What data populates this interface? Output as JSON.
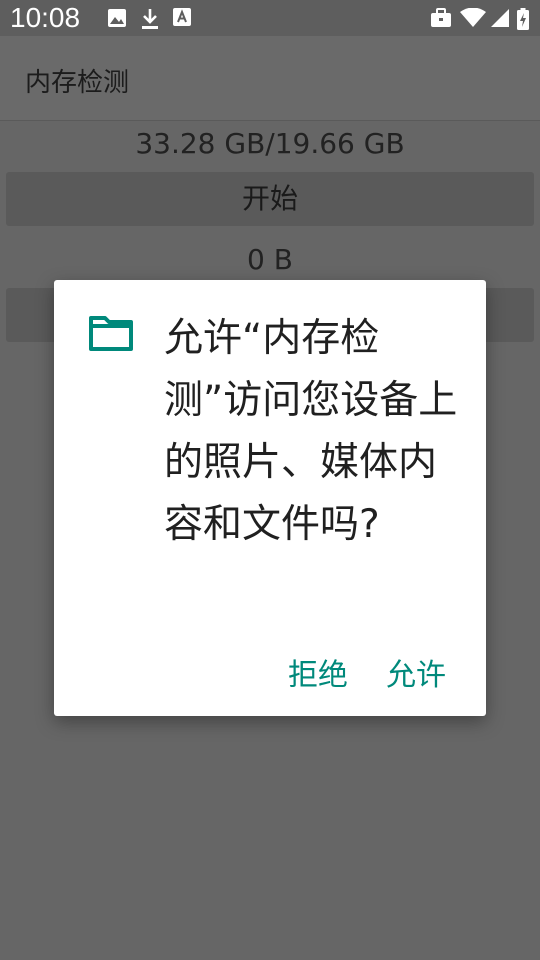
{
  "status_bar": {
    "time": "10:08",
    "icons": [
      "image-icon",
      "download-icon",
      "font-icon",
      "briefcase-icon",
      "wifi-icon",
      "signal-icon",
      "battery-charging-icon"
    ]
  },
  "app": {
    "title": "内存检测"
  },
  "main": {
    "memory_text": "33.28 GB/19.66 GB",
    "start_label": "开始",
    "result_text": "0 B"
  },
  "dialog": {
    "icon": "folder-icon",
    "message": "允许“内存检测”访问您设备上的照片、媒体内容和文件吗?",
    "deny_label": "拒绝",
    "allow_label": "允许"
  },
  "colors": {
    "accent": "#00897b",
    "scrim_background": "#666666",
    "dialog_background": "#ffffff"
  }
}
